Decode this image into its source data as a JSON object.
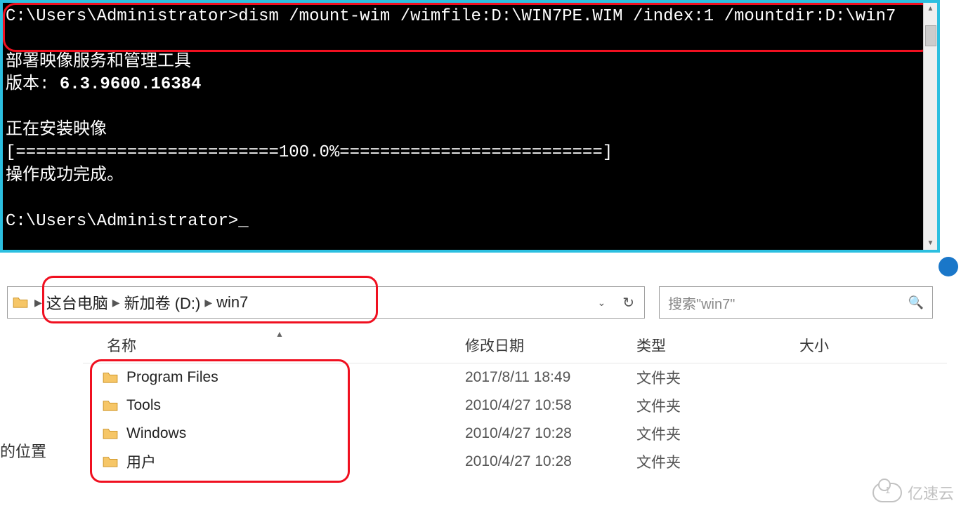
{
  "terminal": {
    "prompt1": "C:\\Users\\Administrator>",
    "command": "dism /mount-wim /wimfile:D:\\WIN7PE.WIM /index:1 /mountdir:D:\\win7",
    "line_blank1": "",
    "line_tool": "部署映像服务和管理工具",
    "line_version_label": "版本: ",
    "line_version_value": "6.3.9600.16384",
    "line_blank2": "",
    "line_mounting": "正在安装映像",
    "line_progress": "[==========================100.0%==========================]",
    "line_success": "操作成功完成。",
    "line_blank3": "",
    "prompt2": "C:\\Users\\Administrator>",
    "cursor": "_"
  },
  "leftcut_text": "的位置",
  "address": {
    "crumb1": "这台电脑",
    "crumb2": "新加卷 (D:)",
    "crumb3": "win7",
    "sep": "▶"
  },
  "search": {
    "placeholder": "搜索\"win7\""
  },
  "columns": {
    "name": "名称",
    "date": "修改日期",
    "type": "类型",
    "size": "大小"
  },
  "rows": [
    {
      "name": "Program Files",
      "date": "2017/8/11 18:49",
      "type": "文件夹",
      "size": ""
    },
    {
      "name": "Tools",
      "date": "2010/4/27 10:58",
      "type": "文件夹",
      "size": ""
    },
    {
      "name": "Windows",
      "date": "2010/4/27 10:28",
      "type": "文件夹",
      "size": ""
    },
    {
      "name": "用户",
      "date": "2010/4/27 10:28",
      "type": "文件夹",
      "size": ""
    }
  ],
  "watermark_text": "亿速云"
}
